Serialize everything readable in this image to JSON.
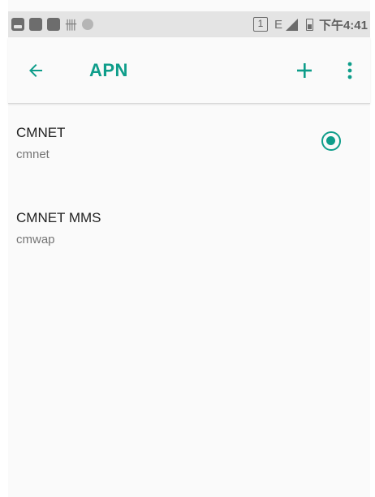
{
  "status_bar": {
    "icons": [
      "image-icon",
      "notification-icon",
      "notification-icon",
      "hash-icon",
      "circle-icon"
    ],
    "sim_slot": "1",
    "network_type": "E",
    "time": "下午4:41"
  },
  "app_bar": {
    "title": "APN",
    "back_icon": "arrow-left-icon",
    "add_icon": "plus-icon",
    "more_icon": "more-vert-icon",
    "accent_color": "#0e9d8a"
  },
  "apn_list": [
    {
      "name": "CMNET",
      "apn": "cmnet",
      "selected": true
    },
    {
      "name": "CMNET MMS",
      "apn": "cmwap",
      "selected": false
    }
  ]
}
